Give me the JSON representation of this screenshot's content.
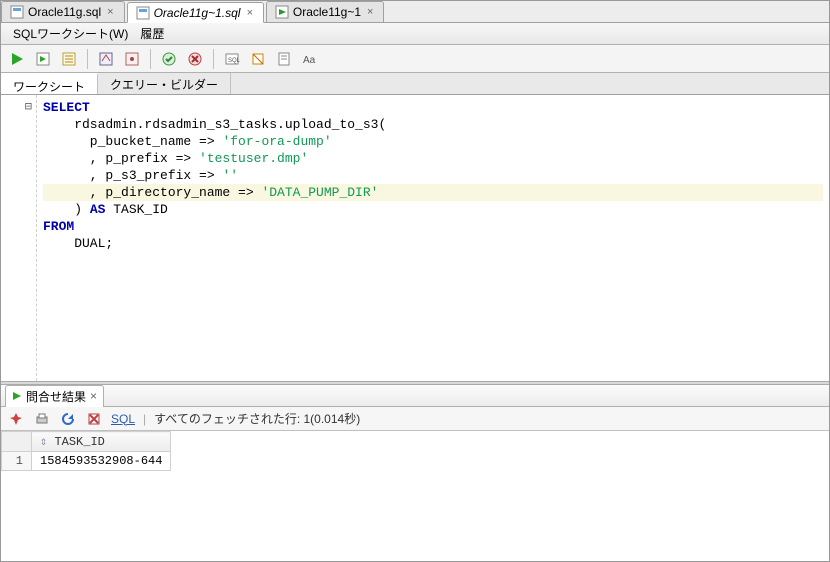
{
  "file_tabs": [
    {
      "label": "Oracle11g.sql",
      "active": false,
      "ext": "sql"
    },
    {
      "label": "Oracle11g~1.sql",
      "active": true,
      "ext": "sql"
    },
    {
      "label": "Oracle11g~1",
      "active": false,
      "ext": "run"
    }
  ],
  "menubar": {
    "worksheet": "SQLワークシート(W)",
    "history": "履歴"
  },
  "ws_tabs": {
    "worksheet": "ワークシート",
    "query_builder": "クエリー・ビルダー"
  },
  "code": {
    "l1": "SELECT",
    "l2": "    rdsadmin.rdsadmin_s3_tasks.upload_to_s3(",
    "l3a": "      p_bucket_name => ",
    "l3b": "'for-ora-dump'",
    "l4a": "      , p_prefix => ",
    "l4b": "'testuser.dmp'",
    "l5a": "      , p_s3_prefix => ",
    "l5b": "''",
    "l6a": "      , p_directory_name => ",
    "l6b": "'DATA_PUMP_DIR'",
    "l7a": "    ) ",
    "l7b": "AS",
    "l7c": " TASK_ID",
    "l8": "FROM",
    "l9": "    DUAL;"
  },
  "results": {
    "tab_label": "問合せ結果",
    "sql_link": "SQL",
    "status": "すべてのフェッチされた行: 1(0.014秒)",
    "column": "TASK_ID",
    "row_value": "1584593532908-644",
    "row_num": "1"
  }
}
